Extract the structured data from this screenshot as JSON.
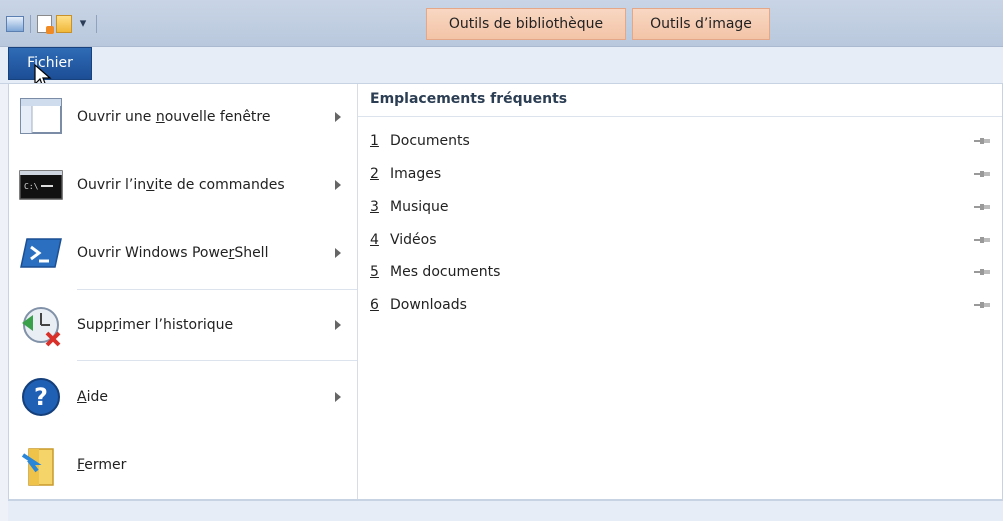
{
  "titlebar": {
    "qat_icons": [
      "save-icon",
      "new-doc-icon",
      "folder-icon",
      "customize-qat-icon"
    ],
    "context_tabs": [
      "Outils de bibliothèque",
      "Outils d’image"
    ]
  },
  "ribbon": {
    "file_tab": "Fichier"
  },
  "menu": {
    "left_items": [
      {
        "label_pre": "Ouvrir une ",
        "mnemonic": "n",
        "label_post": "ouvelle fenêtre",
        "icon": "new-window-icon",
        "has_submenu": true
      },
      {
        "label_pre": "Ouvrir l’in",
        "mnemonic": "v",
        "label_post": "ite de commandes",
        "icon": "command-prompt-icon",
        "has_submenu": true
      },
      {
        "label_pre": "Ouvrir Windows Powe",
        "mnemonic": "r",
        "label_post": "Shell",
        "icon": "powershell-icon",
        "has_submenu": true
      },
      {
        "label_pre": "Supp",
        "mnemonic": "r",
        "label_post": "imer l’historique",
        "icon": "clear-history-icon",
        "has_submenu": true
      },
      {
        "label_pre": "",
        "mnemonic": "A",
        "label_post": "ide",
        "icon": "help-icon",
        "has_submenu": true
      },
      {
        "label_pre": "",
        "mnemonic": "F",
        "label_post": "ermer",
        "icon": "close-folder-icon",
        "has_submenu": false
      }
    ],
    "frequent": {
      "title": "Emplacements fréquents",
      "places": [
        {
          "num": "1",
          "name": "Documents"
        },
        {
          "num": "2",
          "name": "Images"
        },
        {
          "num": "3",
          "name": "Musique"
        },
        {
          "num": "4",
          "name": "Vidéos"
        },
        {
          "num": "5",
          "name": "Mes documents"
        },
        {
          "num": "6",
          "name": "Downloads"
        }
      ]
    }
  },
  "colors": {
    "file_tab": "#1c4e95",
    "context_tab": "#f3c4a7"
  }
}
